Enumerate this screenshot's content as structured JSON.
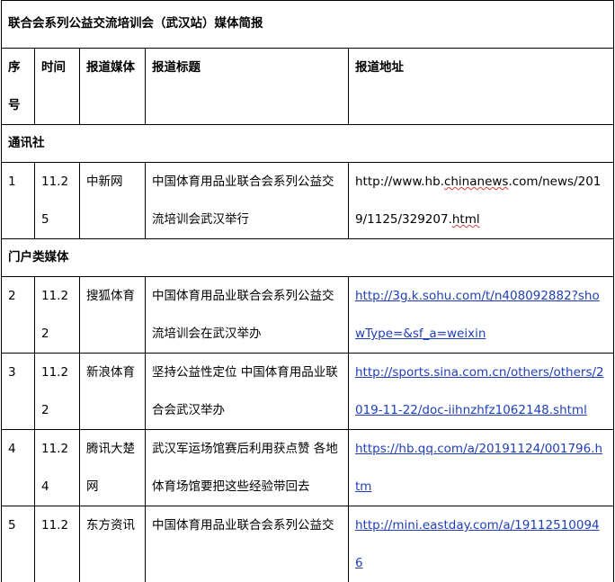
{
  "title": "联合会系列公益交流培训会（武汉站）媒体简报",
  "headers": {
    "seq": "序号",
    "time": "时间",
    "media": "报道媒体",
    "headline": "报道标题",
    "url": "报道地址"
  },
  "sections": [
    {
      "name": "通讯社",
      "rows": [
        {
          "seq": "1",
          "time": "11.25",
          "media": "中新网",
          "headline": "中国体育用品业联合会系列公益交流培训会武汉举行",
          "url_part1": "http://www.hb.",
          "url_part2": "chinanews",
          "url_part3": ".com/news/2019/1125/329207.",
          "url_part4": "html"
        }
      ]
    },
    {
      "name": "门户类媒体",
      "rows": [
        {
          "seq": "2",
          "time": "11.22",
          "media": "搜狐体育",
          "headline": "中国体育用品业联合会系列公益交流培训会在武汉举办",
          "url": "http://3g.k.sohu.com/t/n408092882?showType=&sf_a=weixin"
        },
        {
          "seq": "3",
          "time": "11.22",
          "media": "新浪体育",
          "headline": "坚持公益性定位 中国体育用品业联合会武汉举办",
          "url": "http://sports.sina.com.cn/others/others/2019-11-22/doc-iihnzhfz1062148.shtml"
        },
        {
          "seq": "4",
          "time": "11.24",
          "media": "腾讯大楚网",
          "headline": "武汉军运场馆赛后利用获点赞 各地体育场馆要把这些经验带回去",
          "url": "https://hb.qq.com/a/20191124/001796.htm"
        },
        {
          "seq": "5",
          "time": "11.2",
          "media": "东方资讯",
          "headline": "中国体育用品业联合会系列公益交",
          "url": "http://mini.eastday.com/a/191125100946"
        }
      ]
    }
  ]
}
